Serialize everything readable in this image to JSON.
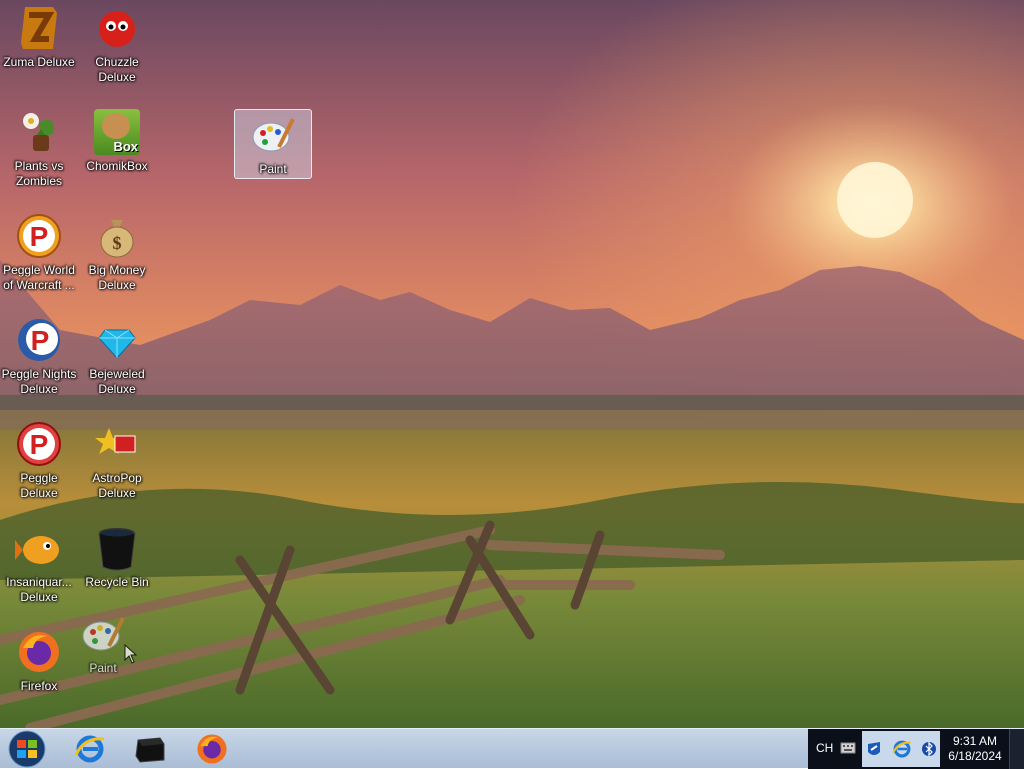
{
  "desktop": {
    "icons": [
      {
        "label": "Zuma Deluxe",
        "icon": "zuma-icon"
      },
      {
        "label": "Chuzzle Deluxe",
        "icon": "chuzzle-icon"
      },
      {
        "label": "Plants vs Zombies",
        "icon": "plants-vs-zombies-icon"
      },
      {
        "label": "ChomikBox",
        "icon": "chomikbox-icon",
        "badge": "Box"
      },
      {
        "label": "Paint",
        "icon": "paint-icon"
      },
      {
        "label": "Peggle World of Warcraft ...",
        "icon": "peggle-icon"
      },
      {
        "label": "Big Money Deluxe",
        "icon": "money-bag-icon"
      },
      {
        "label": "Peggle Nights Deluxe",
        "icon": "peggle-nights-icon"
      },
      {
        "label": "Bejeweled Deluxe",
        "icon": "gem-icon"
      },
      {
        "label": "Peggle Deluxe",
        "icon": "peggle-icon"
      },
      {
        "label": "AstroPop Deluxe",
        "icon": "astropop-icon"
      },
      {
        "label": "Insaniquar... Deluxe",
        "icon": "fish-icon"
      },
      {
        "label": "Recycle Bin",
        "icon": "recycle-bin-icon"
      },
      {
        "label": "Firefox",
        "icon": "firefox-icon"
      },
      {
        "label": "Paint",
        "icon": "paint-icon"
      }
    ],
    "money_symbol": "$"
  },
  "taskbar": {
    "start_icon": "windows-start-icon",
    "pinned": [
      {
        "name": "Internet Explorer",
        "icon": "internet-explorer-icon"
      },
      {
        "name": "Command Prompt",
        "icon": "command-prompt-icon"
      },
      {
        "name": "Firefox",
        "icon": "firefox-icon"
      }
    ],
    "tray": {
      "language": "CH",
      "icons": [
        "keyboard-icon",
        "network-icon",
        "internet-explorer-icon",
        "bluetooth-icon"
      ],
      "time": "9:31 AM",
      "date": "6/18/2024"
    }
  },
  "colors": {
    "taskbar_bg": "#b7c9de",
    "tray_bg": "#0a0f1a",
    "selection": "#d2e1f5"
  }
}
